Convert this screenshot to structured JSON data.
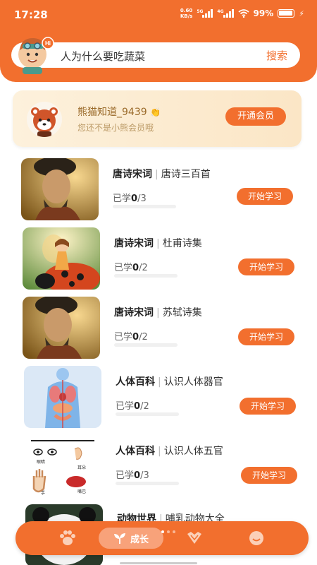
{
  "status_bar": {
    "time": "17:28",
    "net_speed_value": "0.60",
    "net_speed_unit": "KB/s",
    "signal_1": "5G",
    "signal_2": "4G",
    "battery": "99%"
  },
  "search": {
    "placeholder": "人为什么要吃蔬菜",
    "button_label": "搜索",
    "mascot_badge": "Hi"
  },
  "member": {
    "name": "熊猫知道_9439",
    "subtitle": "您还不是小熊会员哦",
    "button_label": "开通会员"
  },
  "courses": [
    {
      "category": "唐诗宋词",
      "name": "唐诗三百首",
      "progress_prefix": "已学",
      "learned": "0",
      "total": "/3",
      "progress": 0,
      "button_label": "开始学习",
      "thumb": "ancient-poet"
    },
    {
      "category": "唐诗宋词",
      "name": "杜甫诗集",
      "progress_prefix": "已学",
      "learned": "0",
      "total": "/2",
      "progress": 0,
      "button_label": "开始学习",
      "thumb": "fairy-on-ladybug"
    },
    {
      "category": "唐诗宋词",
      "name": "苏轼诗集",
      "progress_prefix": "已学",
      "learned": "0",
      "total": "/2",
      "progress": 0,
      "button_label": "开始学习",
      "thumb": "ancient-poet"
    },
    {
      "category": "人体百科",
      "name": "认识人体器官",
      "progress_prefix": "已学",
      "learned": "0",
      "total": "/2",
      "progress": 0,
      "button_label": "开始学习",
      "thumb": "human-organs"
    },
    {
      "category": "人体百科",
      "name": "认识人体五官",
      "progress_prefix": "已学",
      "learned": "0",
      "total": "/3",
      "progress": 0,
      "button_label": "开始学习",
      "thumb": "five-senses",
      "thumb_labels": [
        "眼睛",
        "耳朵",
        "手",
        "嘴巴"
      ]
    },
    {
      "category": "动物世界",
      "name": "哺乳动物大全",
      "thumb": "panda"
    }
  ],
  "tabbar": {
    "active_label": "成长",
    "icons": [
      "paw-icon",
      "sprout-icon",
      "heart-diamond-icon",
      "smile-icon"
    ]
  },
  "colors": {
    "accent": "#f26f2e",
    "member_bg": "#fdf1dc",
    "member_text": "#9a6a2a"
  }
}
